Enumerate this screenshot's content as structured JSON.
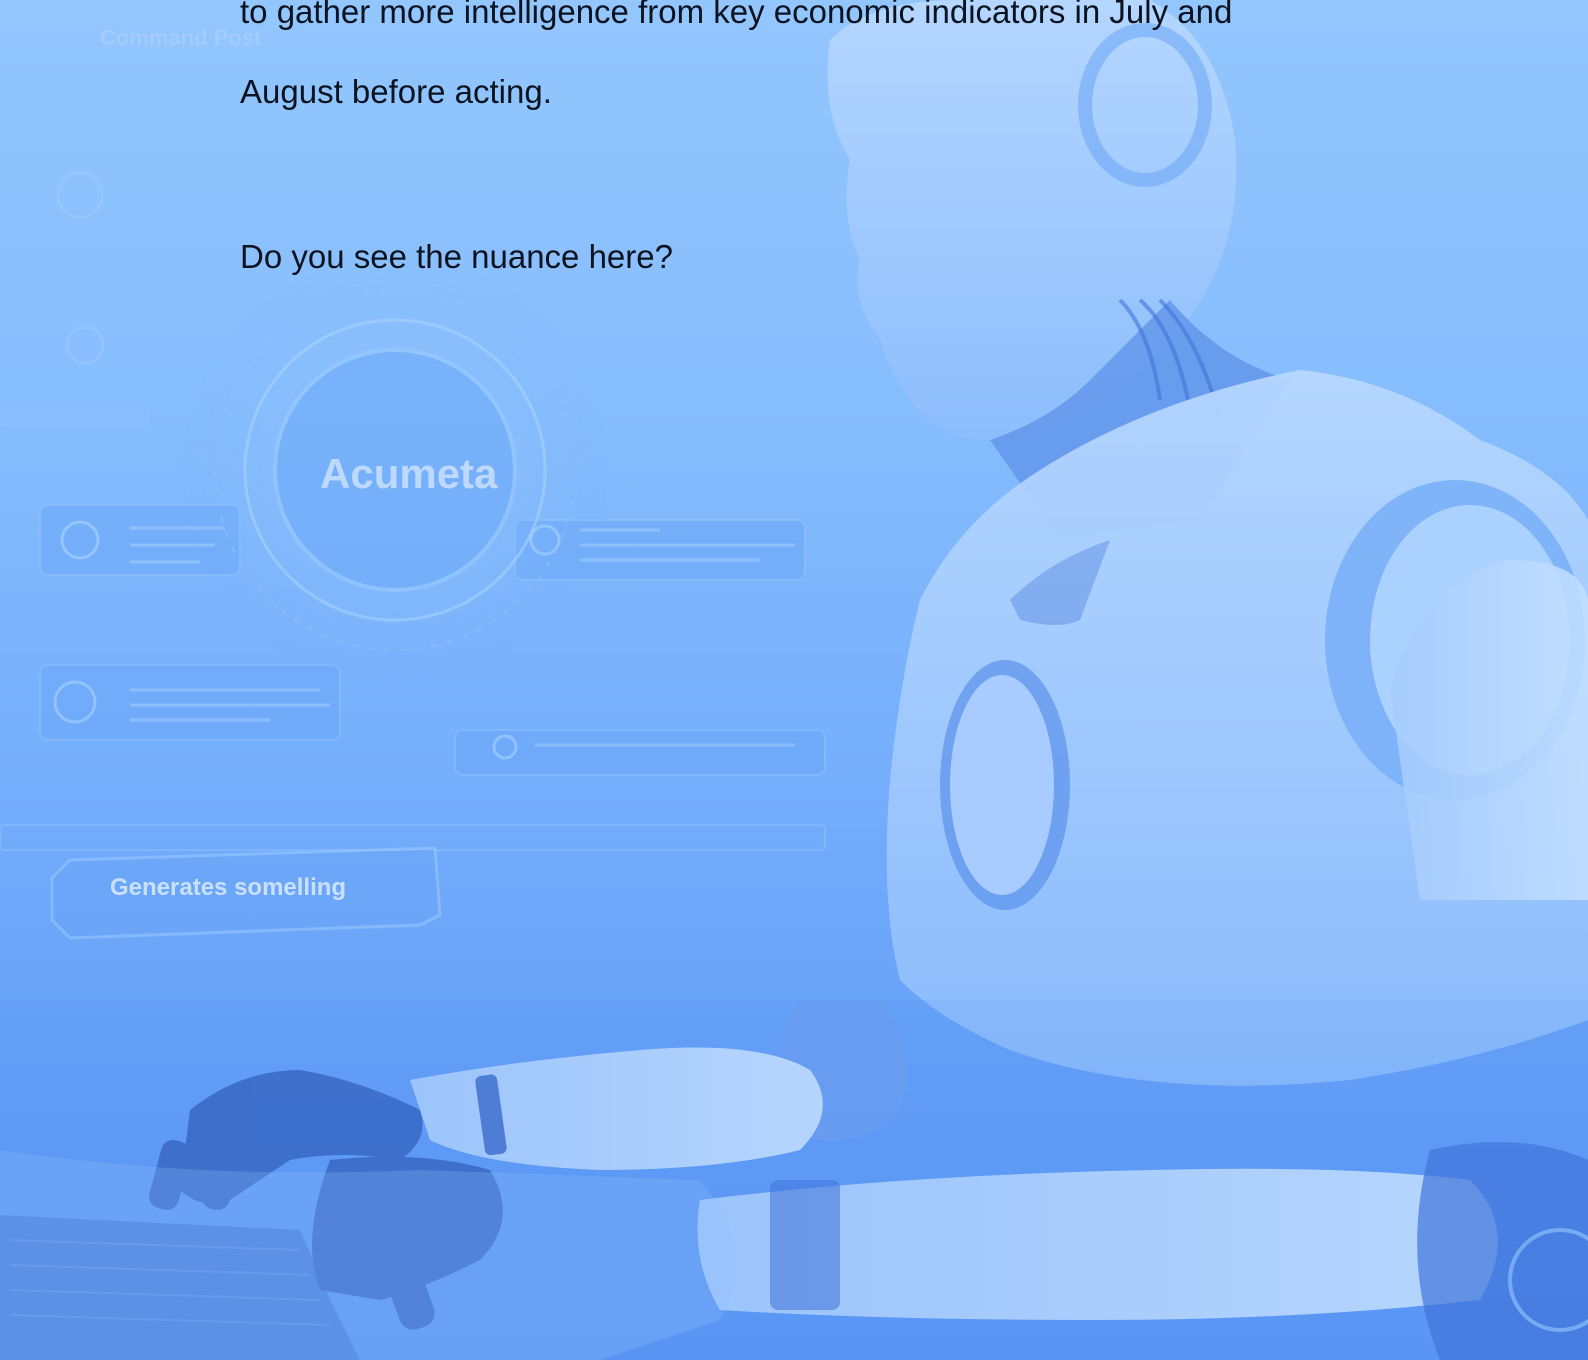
{
  "document": {
    "paragraph_1": {
      "line_1": "to gather more intelligence from key economic indicators in July and",
      "line_2": "August before acting."
    },
    "paragraph_2": "Do you see the nuance here?"
  },
  "background_art": {
    "logo_text": "Acumeta",
    "button_text": "Generates somelling",
    "corner_text": "Command Post",
    "colors": {
      "sky_top": "#93c6fd",
      "sky_bottom": "#5b97f4",
      "robot_highlight": "#c7e0ff",
      "robot_shadow": "#3f74d8",
      "text": "#0b1320"
    }
  }
}
